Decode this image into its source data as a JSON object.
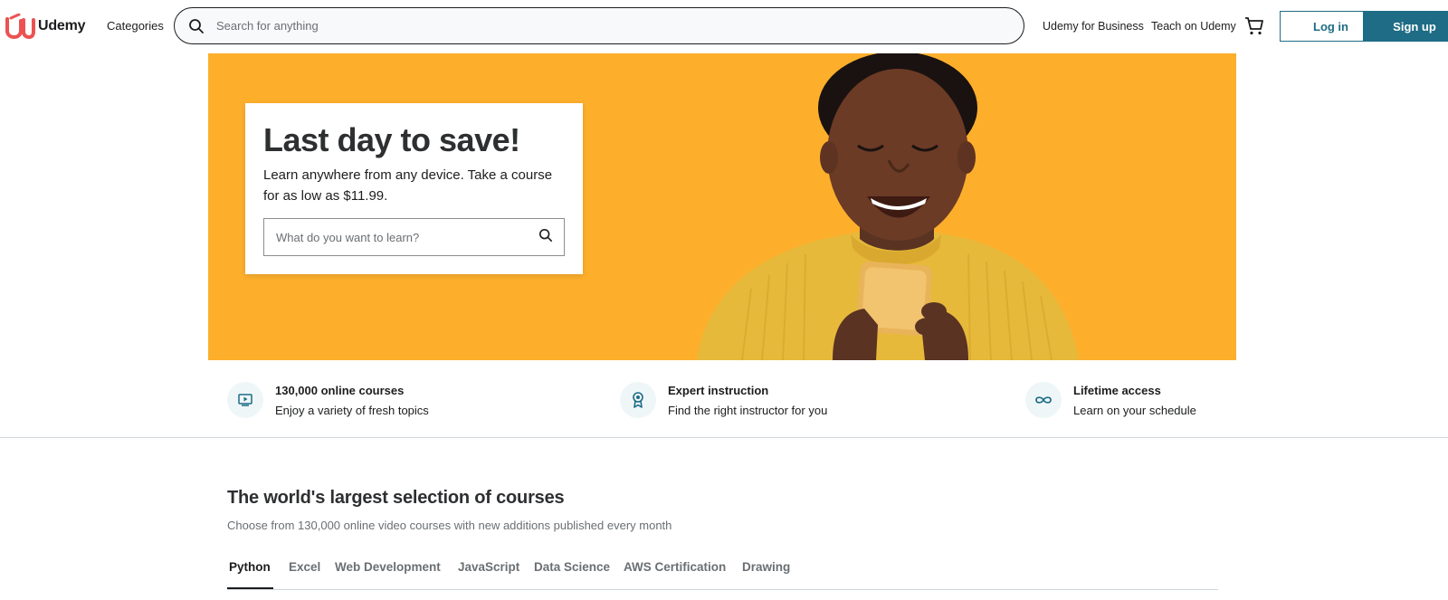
{
  "header": {
    "logo_text": "Udemy",
    "categories_label": "Categories",
    "search_placeholder": "Search for anything",
    "business_label": "Udemy for Business",
    "teach_label": "Teach on Udemy",
    "login_label": "Log in",
    "signup_label": "Sign up",
    "icons": [
      "udemy-logo-icon",
      "search-icon",
      "cart-icon"
    ]
  },
  "hero": {
    "title": "Last day to save!",
    "subtitle": "Learn anywhere from any device. Take a course for as low as $11.99.",
    "search_placeholder": "What do you want to learn?",
    "background_color": "#fdaf2c"
  },
  "features": [
    {
      "icon": "play-video-icon",
      "title": "130,000 online courses",
      "desc": "Enjoy a variety of fresh topics"
    },
    {
      "icon": "award-ribbon-icon",
      "title": "Expert instruction",
      "desc": "Find the right instructor for you"
    },
    {
      "icon": "infinity-icon",
      "title": "Lifetime access",
      "desc": "Learn on your schedule"
    }
  ],
  "courses": {
    "title": "The world's largest selection of courses",
    "subtitle": "Choose from 130,000 online video courses with new additions published every month",
    "tabs": [
      "Python",
      "Excel",
      "Web Development",
      "JavaScript",
      "Data Science",
      "AWS Certification",
      "Drawing"
    ],
    "active_tab": "Python"
  },
  "colors": {
    "brand_red": "#ec5252",
    "brand_teal": "#1e6c85",
    "hero_yellow": "#fdaf2c"
  }
}
